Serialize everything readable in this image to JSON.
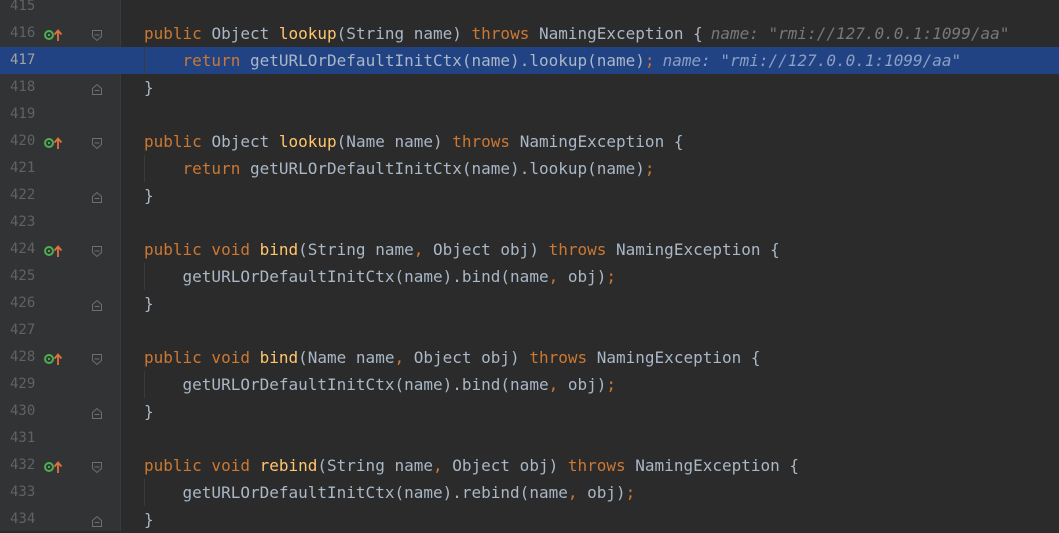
{
  "editor": {
    "language": "java",
    "current_line": "417",
    "colors": {
      "background": "#2b2b2b",
      "gutter": "#313335",
      "current_line_highlight": "#214283",
      "keyword": "#cc7832",
      "method_declaration": "#ffc66d",
      "plain_text": "#a9b7c6",
      "implements_marker": "#4caf50",
      "override_arrow": "#e0703c",
      "inline_hint": "#787878"
    },
    "lines": [
      {
        "num": "415",
        "tokens": []
      },
      {
        "num": "416",
        "impl_marker": "implements-method-icon",
        "fold": "fold-open-icon",
        "tokens": [
          [
            "kw",
            "public "
          ],
          [
            "pl",
            "Object "
          ],
          [
            "fn",
            "lookup"
          ],
          [
            "pl",
            "(String name) "
          ],
          [
            "kw",
            "throws "
          ],
          [
            "pl",
            "NamingException {"
          ]
        ],
        "hint": "name: \"rmi://127.0.0.1:1099/aa\""
      },
      {
        "num": "417",
        "current": true,
        "tokens": [
          [
            "pl",
            "    "
          ],
          [
            "kw",
            "return "
          ],
          [
            "pl",
            "getURLOrDefaultInitCtx(name).lookup(name)"
          ],
          [
            "kw",
            ";"
          ]
        ],
        "hint": "name: \"rmi://127.0.0.1:1099/aa\""
      },
      {
        "num": "418",
        "fold": "fold-close-icon",
        "tokens": [
          [
            "pl",
            "}"
          ]
        ]
      },
      {
        "num": "419",
        "tokens": []
      },
      {
        "num": "420",
        "impl_marker": "implements-method-icon",
        "fold": "fold-open-icon",
        "tokens": [
          [
            "kw",
            "public "
          ],
          [
            "pl",
            "Object "
          ],
          [
            "fn",
            "lookup"
          ],
          [
            "pl",
            "(Name name) "
          ],
          [
            "kw",
            "throws "
          ],
          [
            "pl",
            "NamingException {"
          ]
        ]
      },
      {
        "num": "421",
        "tokens": [
          [
            "pl",
            "    "
          ],
          [
            "kw",
            "return "
          ],
          [
            "pl",
            "getURLOrDefaultInitCtx(name).lookup(name)"
          ],
          [
            "kw",
            ";"
          ]
        ]
      },
      {
        "num": "422",
        "fold": "fold-close-icon",
        "tokens": [
          [
            "pl",
            "}"
          ]
        ]
      },
      {
        "num": "423",
        "tokens": []
      },
      {
        "num": "424",
        "impl_marker": "implements-method-icon",
        "fold": "fold-open-icon",
        "tokens": [
          [
            "kw",
            "public void "
          ],
          [
            "fn",
            "bind"
          ],
          [
            "pl",
            "(String name"
          ],
          [
            "kw",
            ", "
          ],
          [
            "pl",
            "Object obj) "
          ],
          [
            "kw",
            "throws "
          ],
          [
            "pl",
            "NamingException {"
          ]
        ]
      },
      {
        "num": "425",
        "tokens": [
          [
            "pl",
            "    getURLOrDefaultInitCtx(name).bind(name"
          ],
          [
            "kw",
            ", "
          ],
          [
            "pl",
            "obj)"
          ],
          [
            "kw",
            ";"
          ]
        ]
      },
      {
        "num": "426",
        "fold": "fold-close-icon",
        "tokens": [
          [
            "pl",
            "}"
          ]
        ]
      },
      {
        "num": "427",
        "tokens": []
      },
      {
        "num": "428",
        "impl_marker": "implements-method-icon",
        "fold": "fold-open-icon",
        "tokens": [
          [
            "kw",
            "public void "
          ],
          [
            "fn",
            "bind"
          ],
          [
            "pl",
            "(Name name"
          ],
          [
            "kw",
            ", "
          ],
          [
            "pl",
            "Object obj) "
          ],
          [
            "kw",
            "throws "
          ],
          [
            "pl",
            "NamingException {"
          ]
        ]
      },
      {
        "num": "429",
        "tokens": [
          [
            "pl",
            "    getURLOrDefaultInitCtx(name).bind(name"
          ],
          [
            "kw",
            ", "
          ],
          [
            "pl",
            "obj)"
          ],
          [
            "kw",
            ";"
          ]
        ]
      },
      {
        "num": "430",
        "fold": "fold-close-icon",
        "tokens": [
          [
            "pl",
            "}"
          ]
        ]
      },
      {
        "num": "431",
        "tokens": []
      },
      {
        "num": "432",
        "impl_marker": "implements-method-icon",
        "fold": "fold-open-icon",
        "tokens": [
          [
            "kw",
            "public void "
          ],
          [
            "fn",
            "rebind"
          ],
          [
            "pl",
            "(String name"
          ],
          [
            "kw",
            ", "
          ],
          [
            "pl",
            "Object obj) "
          ],
          [
            "kw",
            "throws "
          ],
          [
            "pl",
            "NamingException {"
          ]
        ]
      },
      {
        "num": "433",
        "tokens": [
          [
            "pl",
            "    getURLOrDefaultInitCtx(name).rebind(name"
          ],
          [
            "kw",
            ", "
          ],
          [
            "pl",
            "obj)"
          ],
          [
            "kw",
            ";"
          ]
        ]
      },
      {
        "num": "434",
        "fold": "fold-close-icon",
        "tokens": [
          [
            "pl",
            "}"
          ]
        ]
      }
    ]
  }
}
